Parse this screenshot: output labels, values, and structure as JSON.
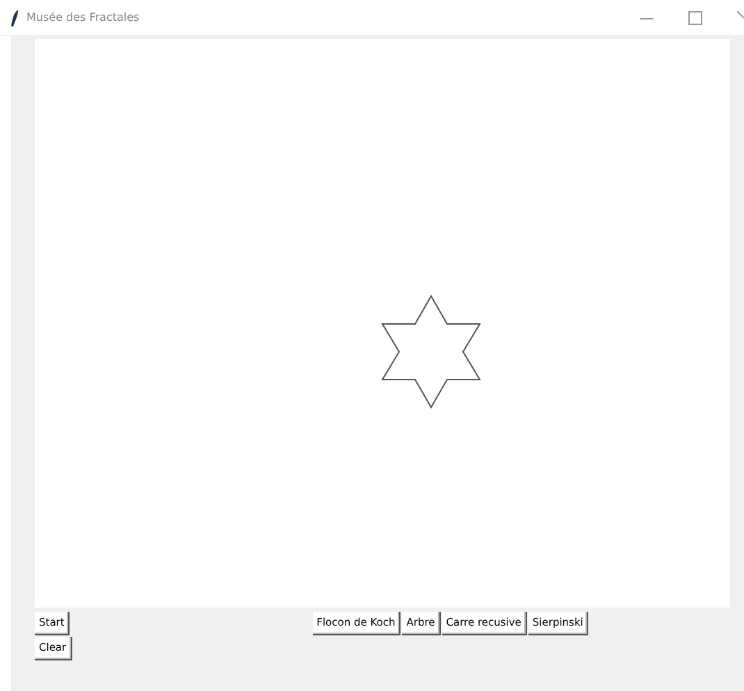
{
  "window": {
    "title": "Musée des Fractales"
  },
  "side_buttons": [
    {
      "label": "Start"
    },
    {
      "label": "Clear"
    }
  ],
  "fractal_buttons": [
    {
      "label": "Flocon de Koch"
    },
    {
      "label": "Arbre"
    },
    {
      "label": "Carre recusive"
    },
    {
      "label": "Sierpinski"
    }
  ]
}
